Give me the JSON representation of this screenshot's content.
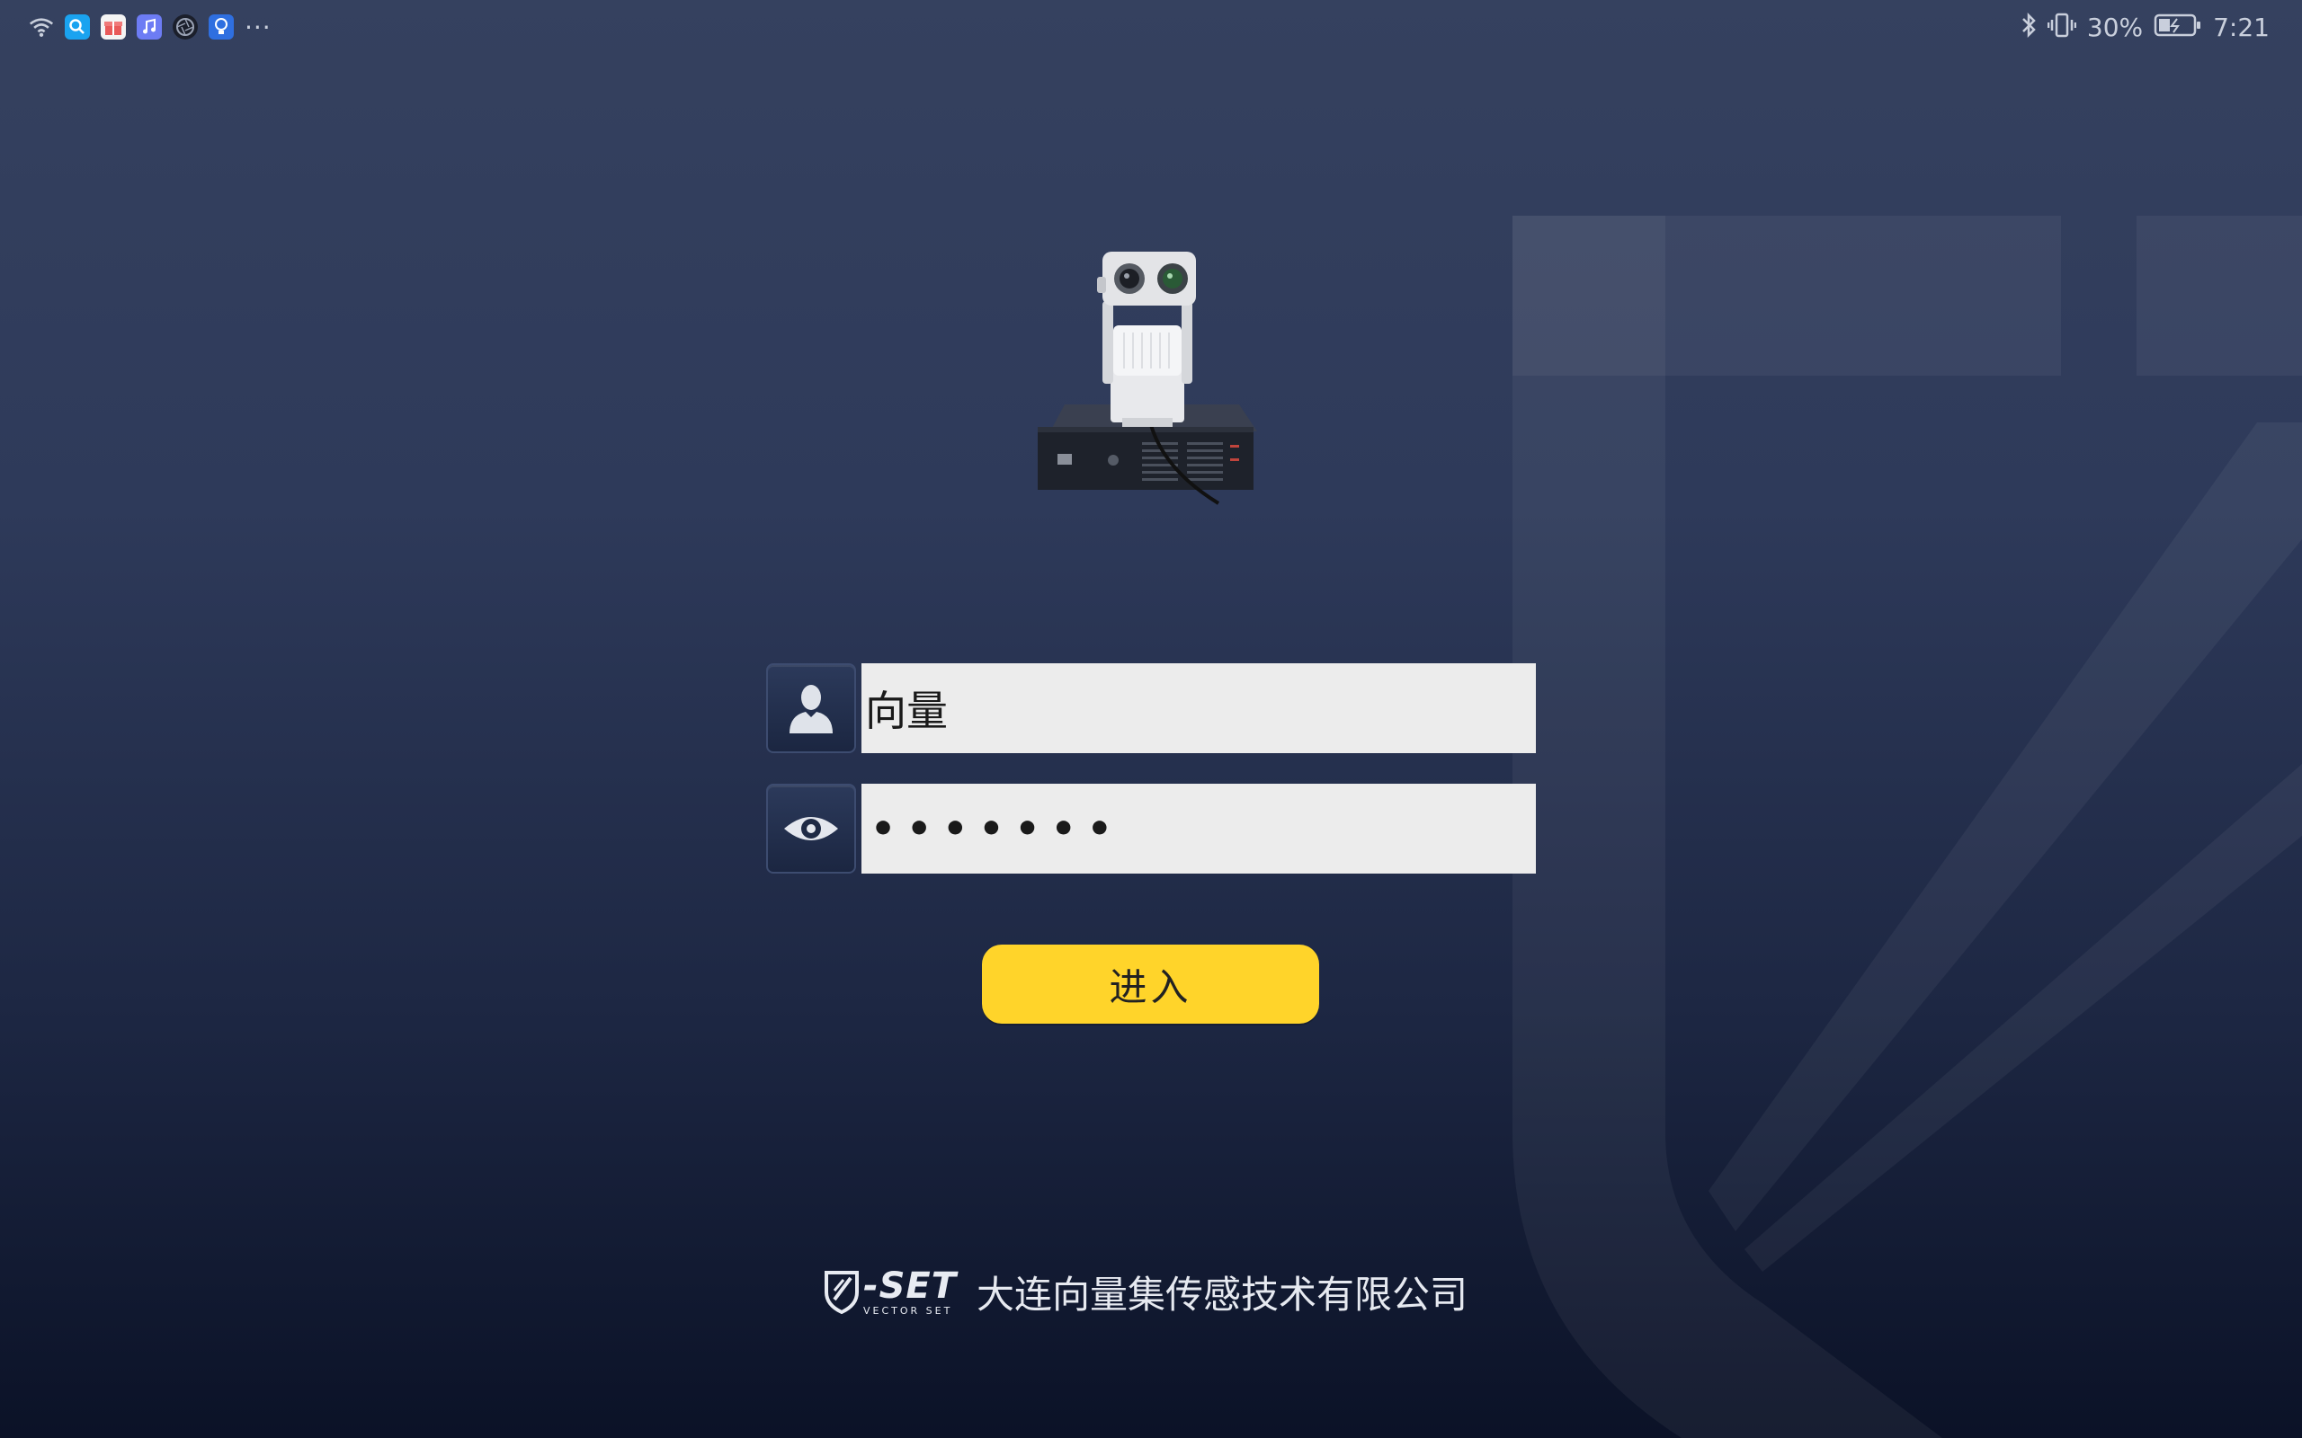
{
  "status_bar": {
    "apps": [
      "wifi-icon",
      "search-app-icon",
      "gift-app-icon",
      "music-app-icon",
      "camera-app-icon",
      "bulb-app-icon"
    ],
    "more": "···",
    "battery_percent": "30%",
    "time": "7:21"
  },
  "login": {
    "username_value": "向量",
    "password_mask": "•••••••",
    "enter_label": "进入"
  },
  "footer": {
    "brand_big": "-SET",
    "brand_small": "VECTOR SET",
    "company": "大连向量集传感技术有限公司"
  },
  "colors": {
    "button": "#ffd42a",
    "background_top": "#35415f",
    "background_bottom": "#0b1227",
    "field": "#ececec"
  }
}
